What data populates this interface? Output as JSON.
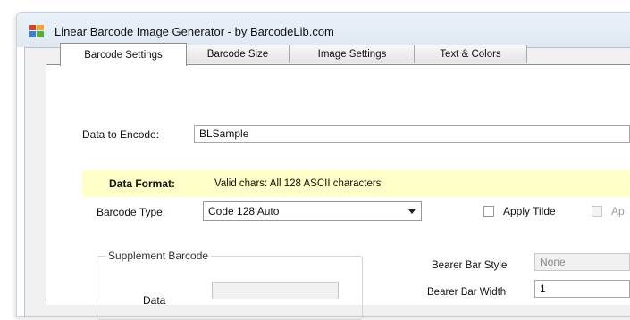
{
  "window": {
    "title": "Linear Barcode Image Generator - by BarcodeLib.com"
  },
  "tabs": [
    {
      "label": "Barcode Settings",
      "active": true
    },
    {
      "label": "Barcode Size",
      "active": false
    },
    {
      "label": "Image Settings",
      "active": false
    },
    {
      "label": "Text & Colors",
      "active": false
    }
  ],
  "data_to_encode": {
    "label": "Data to Encode:",
    "value": "BLSample"
  },
  "data_format": {
    "label": "Data Format:",
    "value": "Valid chars: All 128 ASCII characters",
    "bg_color": "#ffffc8"
  },
  "barcode_type": {
    "label": "Barcode Type:",
    "selected": "Code 128 Auto"
  },
  "checkboxes": {
    "apply_tilde": "Apply Tilde",
    "second_partial": "Ap"
  },
  "supplement": {
    "group_title": "Supplement Barcode",
    "data_label": "Data",
    "data_value": ""
  },
  "bearer_bar": {
    "style_label": "Bearer Bar Style",
    "style_value": "None",
    "width_label": "Bearer Bar Width",
    "width_value": "1"
  },
  "icons": {
    "app": "barcode-app-icon",
    "dropdown": "chevron-down-icon"
  }
}
